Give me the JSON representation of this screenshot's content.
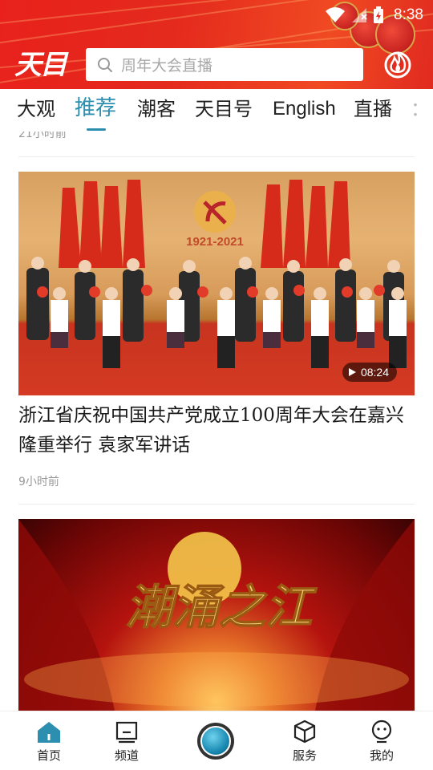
{
  "status_bar": {
    "time": "8:38"
  },
  "header": {
    "logo_text": "天目",
    "search_placeholder": "周年大会直播",
    "accent_color": "#e8211c"
  },
  "tabs": [
    {
      "label": "大观",
      "active": false
    },
    {
      "label": "推荐",
      "active": true
    },
    {
      "label": "潮客",
      "active": false
    },
    {
      "label": "天目号",
      "active": false
    },
    {
      "label": "English",
      "active": false
    },
    {
      "label": "直播",
      "active": false
    },
    {
      "label": "：",
      "active": false
    }
  ],
  "feed": {
    "previous_item_time": "21小时前",
    "items": [
      {
        "video_duration": "08:24",
        "image_text": "1921-2021",
        "title": "浙江省庆祝中国共产党成立100周年大会在嘉兴隆重举行  袁家军讲话",
        "time": "9小时前"
      },
      {
        "image_text": "潮涌之江"
      }
    ]
  },
  "bottom_nav": [
    {
      "label": "首页",
      "icon": "home-icon",
      "active": true
    },
    {
      "label": "频道",
      "icon": "channel-icon",
      "active": false
    },
    {
      "label": "",
      "icon": "camera-orb-icon",
      "active": false
    },
    {
      "label": "服务",
      "icon": "cube-icon",
      "active": false
    },
    {
      "label": "我的",
      "icon": "profile-icon",
      "active": false
    }
  ],
  "colors": {
    "tab_active": "#2d8fb0",
    "header_red": "#e8211c",
    "meta_gray": "#999999"
  }
}
